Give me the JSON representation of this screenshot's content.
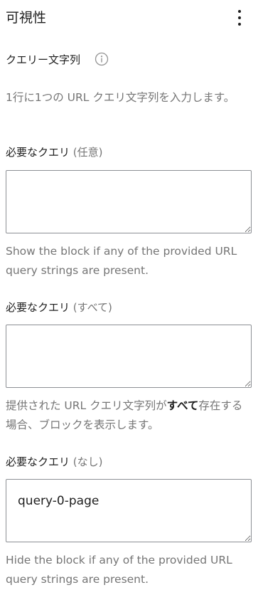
{
  "panel": {
    "title": "可視性",
    "menu_icon": "more-vertical-icon"
  },
  "query_strings": {
    "label": "クエリー文字列",
    "info_icon": "info-icon",
    "help": "1行に1つの URL クエリ文字列を入力します。"
  },
  "fields": [
    {
      "label": "必要なクエリ",
      "qualifier": "(任意)",
      "value": "",
      "help": "Show the block if any of the provided URL query strings are present."
    },
    {
      "label": "必要なクエリ",
      "qualifier": "(すべて)",
      "value": "",
      "help_before": "提供された URL クエリ文字列が",
      "help_bold": "すべて",
      "help_after": "存在する場合、ブロックを表示します。"
    },
    {
      "label": "必要なクエリ",
      "qualifier": "(なし)",
      "value": "query-0-page",
      "help": "Hide the block if any of the provided URL query strings are present."
    }
  ],
  "colors": {
    "text": "#1e1e1e",
    "muted": "#757575",
    "border": "#8c8f94"
  }
}
